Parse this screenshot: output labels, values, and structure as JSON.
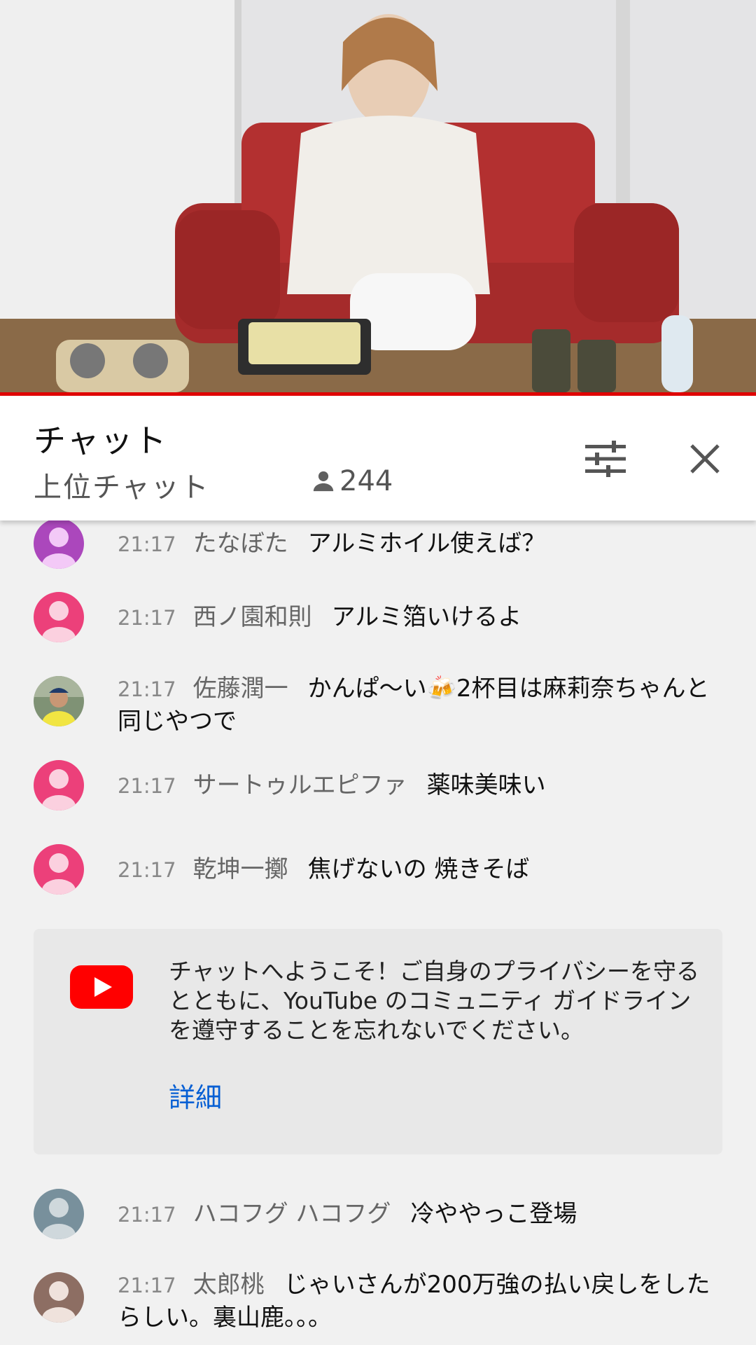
{
  "chat": {
    "title": "チャット",
    "mode": "上位チャット",
    "viewer_count": "244"
  },
  "messages": [
    {
      "time": "21:17",
      "author": "たなぼた",
      "text": "アルミホイル使えば？",
      "avatar_color": "#ab47bc"
    },
    {
      "time": "21:17",
      "author": "西ノ園和則",
      "text": "アルミ箔いけるよ",
      "avatar_color": "#ec407a"
    },
    {
      "time": "21:17",
      "author": "佐藤潤一",
      "text": "かんぱ〜い🍻2杯目は麻莉奈ちゃんと同じやつで",
      "avatar_color": "#7a8a6a"
    },
    {
      "time": "21:17",
      "author": "サートゥルエピファ",
      "text": "薬味美味い",
      "avatar_color": "#ec407a"
    },
    {
      "time": "21:17",
      "author": "乾坤一擲",
      "text": "焦げないの 焼きそば",
      "avatar_color": "#ec407a"
    }
  ],
  "welcome": {
    "text": "チャットへようこそ！ご自身のプライバシーを守るとともに、YouTube のコミュニティ ガイドラインを遵守することを忘れないでください。",
    "link": "詳細"
  },
  "messages_after": [
    {
      "time": "21:17",
      "author": "ハコフグ ハコフグ",
      "text": "冷ややっこ登場",
      "avatar_color": "#78909c"
    },
    {
      "time": "21:17",
      "author": "太郎桃",
      "text": "じゃいさんが200万強の払い戻しをしたらしい。裏山鹿。。。",
      "avatar_color": "#8d6e63"
    }
  ],
  "colors": {
    "accent_red": "#e00000",
    "link_blue": "#065fd4",
    "background": "#f1f1f1"
  },
  "icons": [
    "person-icon",
    "tune-icon",
    "close-icon",
    "youtube-logo-icon"
  ]
}
